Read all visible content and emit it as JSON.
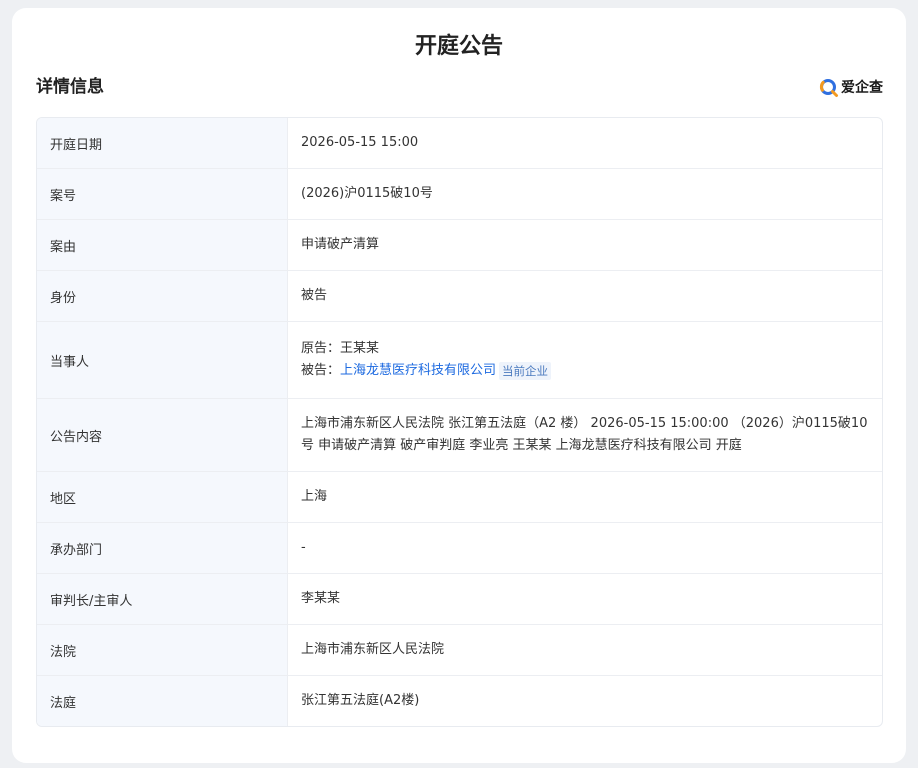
{
  "page": {
    "title": "开庭公告",
    "section_title": "详情信息",
    "brand_name": "爱企查"
  },
  "colors": {
    "accent": "#1d6ae0",
    "brand_orange": "#f39a21",
    "brand_blue": "#2f6fe0",
    "label_bg": "#f5f8fd"
  },
  "details": {
    "date": {
      "label": "开庭日期",
      "value": "2026-05-15 15:00"
    },
    "case_no": {
      "label": "案号",
      "value": "(2026)沪0115破10号"
    },
    "cause": {
      "label": "案由",
      "value": "申请破产清算"
    },
    "identity": {
      "label": "身份",
      "value": "被告"
    },
    "parties": {
      "label": "当事人",
      "plaintiff_prefix": "原告：",
      "plaintiff": "王某某",
      "defendant_prefix": "被告：",
      "defendant": "上海龙慧医疗科技有限公司",
      "current_badge": "当前企业"
    },
    "content": {
      "label": "公告内容",
      "value": "上海市浦东新区人民法院 张江第五法庭（A2 楼） 2026-05-15 15:00:00 （2026）沪0115破10号 申请破产清算 破产审判庭 李业亮 王某某 上海龙慧医疗科技有限公司 开庭"
    },
    "region": {
      "label": "地区",
      "value": "上海"
    },
    "department": {
      "label": "承办部门",
      "value": "-"
    },
    "judge": {
      "label": "审判长/主审人",
      "value": "李某某"
    },
    "court": {
      "label": "法院",
      "value": "上海市浦东新区人民法院"
    },
    "courtroom": {
      "label": "法庭",
      "value": "张江第五法庭(A2楼)"
    }
  }
}
